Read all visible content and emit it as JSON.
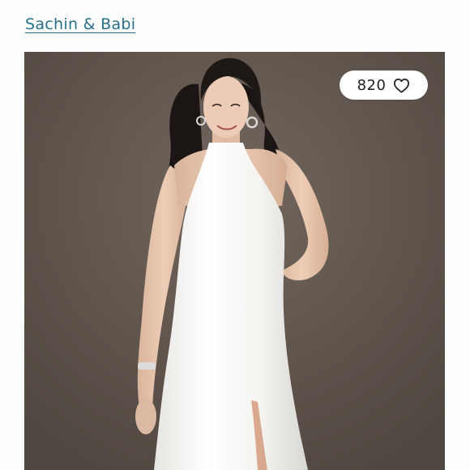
{
  "listing": {
    "brand": "Sachin & Babi",
    "likes": "820",
    "like_icon": "heart-icon",
    "photo": "product-photo"
  },
  "colors": {
    "brand_link": "#2a6f8a",
    "photo_background": "#5e534b",
    "page_background": "#fbfefd"
  }
}
